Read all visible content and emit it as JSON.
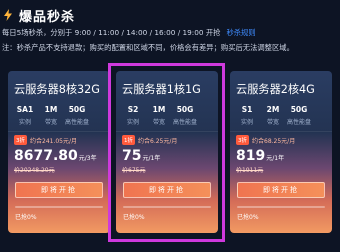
{
  "header": {
    "title": "爆品秒杀",
    "schedule": "每日5场秒杀，分别于 9:00 / 11:00 / 14:00 / 16:00 / 19:00 开抢",
    "rule_link": "秒杀规则",
    "note": "注：秒杀产品不支持退款；购买的配置和区域不同，价格会有差异；购买后无法调整区域。"
  },
  "cards": [
    {
      "name": "云服务器8核32G",
      "specs": [
        {
          "value": "SA1",
          "label": "实例"
        },
        {
          "value": "1M",
          "label": "带宽"
        },
        {
          "value": "50G",
          "label": "高性能盘"
        }
      ],
      "badge": "3折",
      "promo": "约合241.05元/月",
      "price": "8677.80",
      "unit": "元/3年",
      "original": "价20248.20元",
      "buy_label": "即将开抢",
      "sold_pct": 0,
      "sold_text": "已抢0%"
    },
    {
      "name": "云服务器1核1G",
      "specs": [
        {
          "value": "S2",
          "label": "实例"
        },
        {
          "value": "1M",
          "label": "带宽"
        },
        {
          "value": "50G",
          "label": "高性能盘"
        }
      ],
      "badge": "1折",
      "promo": "约合6.25元/月",
      "price": "75",
      "unit": "元/1年",
      "original": "价675元",
      "buy_label": "即将开抢",
      "sold_pct": 0,
      "sold_text": "已抢0%"
    },
    {
      "name": "云服务器2核4G",
      "specs": [
        {
          "value": "S1",
          "label": "实例"
        },
        {
          "value": "2M",
          "label": "带宽"
        },
        {
          "value": "50G",
          "label": "高性能盘"
        }
      ],
      "badge": "3折",
      "promo": "约合68.25元/月",
      "price": "819",
      "unit": "元/1年",
      "original": "价1911元",
      "buy_label": "即将开抢",
      "sold_pct": 0,
      "sold_text": "已抢0%"
    }
  ],
  "colors": {
    "background": "#0d1424",
    "accent_link": "#3f8cff",
    "highlight": "#cf39dd",
    "badge": "#ff5a3c"
  }
}
